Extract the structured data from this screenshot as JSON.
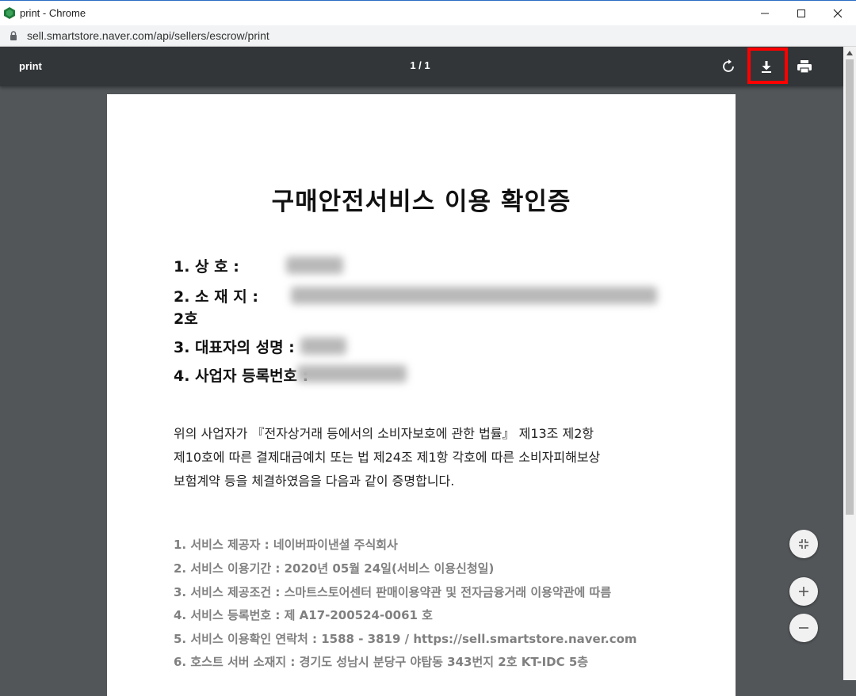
{
  "window": {
    "title": "print - Chrome",
    "url": "sell.smartstore.naver.com/api/sellers/escrow/print"
  },
  "pdf_toolbar": {
    "doc_title": "print",
    "page_count": "1 / 1"
  },
  "document": {
    "heading": "구매안전서비스 이용 확인증",
    "info": [
      {
        "label": "1. 상          호  :"
      },
      {
        "label": "2. 소    재    지  :"
      },
      {
        "label": "3. 대표자의 성명  :"
      },
      {
        "label": "4. 사업자 등록번호 :"
      }
    ],
    "address_wrap": "2호",
    "body_lines": [
      "위의 사업자가 『전자상거래 등에서의 소비자보호에 관한 법률』 제13조 제2항",
      "제10호에 따른 결제대금예치 또는 법 제24조 제1항 각호에 따른 소비자피해보상",
      "보험계약 등을 체결하였음을 다음과 같이 증명합니다."
    ],
    "services": [
      "1. 서비스 제공자 : 네이버파이낸셜 주식회사",
      "2. 서비스 이용기간 : 2020년 05월 24일(서비스 이용신청일)",
      "3. 서비스 제공조건 : 스마트스토어센터 판매이용약관 및 전자금융거래 이용약관에 따름",
      "4. 서비스 등록번호 : 제 A17-200524-0061 호",
      "5. 서비스 이용확인 연락처 : 1588 - 3819 / https://sell.smartstore.naver.com",
      "6. 호스트 서버 소재지 : 경기도 성남시 분당구 야탑동 343번지 2호 KT-IDC 5층"
    ]
  },
  "icons": {
    "rotate": "rotate-icon",
    "download": "download-icon",
    "print": "print-icon",
    "fit": "fit-page-icon",
    "zoom_in": "zoom-in-icon",
    "zoom_out": "zoom-out-icon"
  },
  "colors": {
    "highlight": "#ff0000",
    "toolbar": "#323639",
    "viewer_bg": "#525659"
  }
}
